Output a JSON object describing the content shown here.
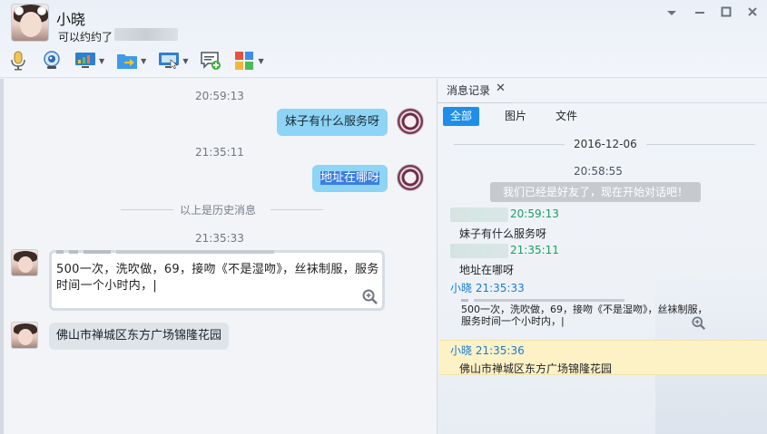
{
  "contact": {
    "name": "小晓",
    "signature": "可以约约了"
  },
  "window_controls": {
    "menu_icon": "chevron-down-icon",
    "minimize_icon": "minimize-icon",
    "maximize_icon": "maximize-icon",
    "close_icon": "close-icon"
  },
  "toolbar": {
    "items": [
      {
        "name": "voice-call",
        "icon": "microphone-icon"
      },
      {
        "name": "video-call",
        "icon": "webcam-icon"
      },
      {
        "name": "remote-desktop",
        "icon": "monitor-icon"
      },
      {
        "name": "send-file",
        "icon": "folder-send-icon"
      },
      {
        "name": "screen-share",
        "icon": "screen-share-icon"
      },
      {
        "name": "start-discussion",
        "icon": "chat-add-icon"
      },
      {
        "name": "apps",
        "icon": "apps-grid-icon"
      }
    ]
  },
  "chat": {
    "messages": [
      {
        "time": "20:59:13",
        "text": "妹子有什么服务呀",
        "direction": "out"
      },
      {
        "time": "21:35:11",
        "text": "地址在哪呀",
        "direction": "out",
        "selected": true
      },
      {
        "history_divider": "以上是历史消息"
      },
      {
        "time": "21:35:33",
        "text": "500一次，洗吹做，69，接吻《不是湿吻》，丝袜制服，服务时间一个小时内，|",
        "direction": "in",
        "type": "image-text"
      },
      {
        "text": "佛山市禅城区东方广场锦隆花园",
        "direction": "in"
      }
    ]
  },
  "history_panel": {
    "tab_label": "消息记录",
    "filters": [
      "全部",
      "图片",
      "文件"
    ],
    "active_filter": "全部",
    "date": "2016-12-06",
    "entries": [
      {
        "time": "20:58:55",
        "system_text": "我们已经是好友了，现在开始对话吧！"
      },
      {
        "sender": "",
        "time": "20:59:13",
        "text": "妹子有什么服务呀",
        "color": "#1aa05a"
      },
      {
        "sender": "",
        "time": "21:35:11",
        "text": "地址在哪呀",
        "color": "#1aa05a"
      },
      {
        "sender": "小晓",
        "time": "21:35:33",
        "text": "500一次，洗吹做，69，接吻《不是湿吻》，丝袜制服，服务时间一个小时内，|",
        "color": "#1a7ad4"
      },
      {
        "sender": "小晓",
        "time": "21:35:36",
        "text": "佛山市禅城区东方广场锦隆花园",
        "color": "#1a7ad4",
        "highlighted": true
      }
    ]
  }
}
